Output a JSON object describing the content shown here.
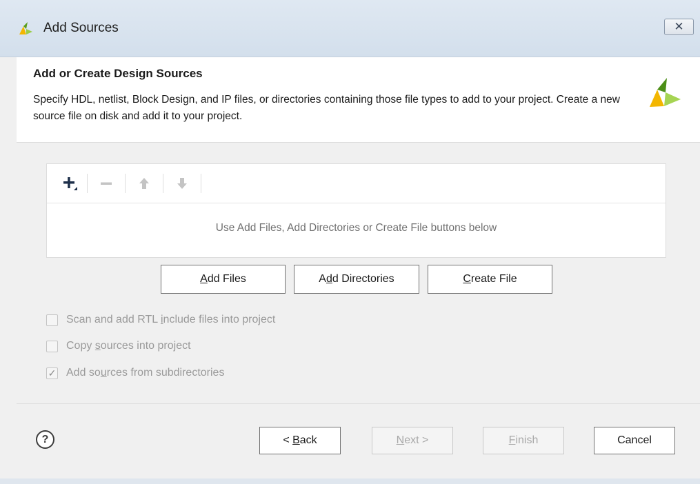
{
  "window": {
    "title": "Add Sources",
    "close_icon": "close-icon"
  },
  "header": {
    "title": "Add or Create Design Sources",
    "description": "Specify HDL, netlist, Block Design, and IP files, or directories containing those file types to add to your project. Create a new source file on disk and add it to your project."
  },
  "file_panel": {
    "toolbar": {
      "add": "add-icon",
      "remove": "remove-icon",
      "move_up": "arrow-up-icon",
      "move_down": "arrow-down-icon"
    },
    "empty_message": "Use Add Files, Add Directories or Create File buttons below"
  },
  "actions": {
    "add_files": {
      "pre": "",
      "mnemonic": "A",
      "post": "dd Files"
    },
    "add_directories": {
      "pre": "A",
      "mnemonic": "d",
      "post": "d Directories"
    },
    "create_file": {
      "pre": "",
      "mnemonic": "C",
      "post": "reate File"
    }
  },
  "options": [
    {
      "pre": "Scan and add RTL ",
      "mnemonic": "i",
      "post": "nclude files into project",
      "checked": false,
      "enabled": false
    },
    {
      "pre": "Copy ",
      "mnemonic": "s",
      "post": "ources into project",
      "checked": false,
      "enabled": false
    },
    {
      "pre": "Add so",
      "mnemonic": "u",
      "post": "rces from subdirectories",
      "checked": true,
      "enabled": false
    }
  ],
  "footer": {
    "help": "?",
    "back": {
      "pre": "< ",
      "mnemonic": "B",
      "post": "ack"
    },
    "next": {
      "pre": "",
      "mnemonic": "N",
      "post": "ext >"
    },
    "finish": {
      "pre": "",
      "mnemonic": "F",
      "post": "inish"
    },
    "cancel": "Cancel"
  },
  "colors": {
    "logo_yellow": "#f3b600",
    "logo_green": "#76b82a",
    "titlebar": "#d7e2ee"
  }
}
